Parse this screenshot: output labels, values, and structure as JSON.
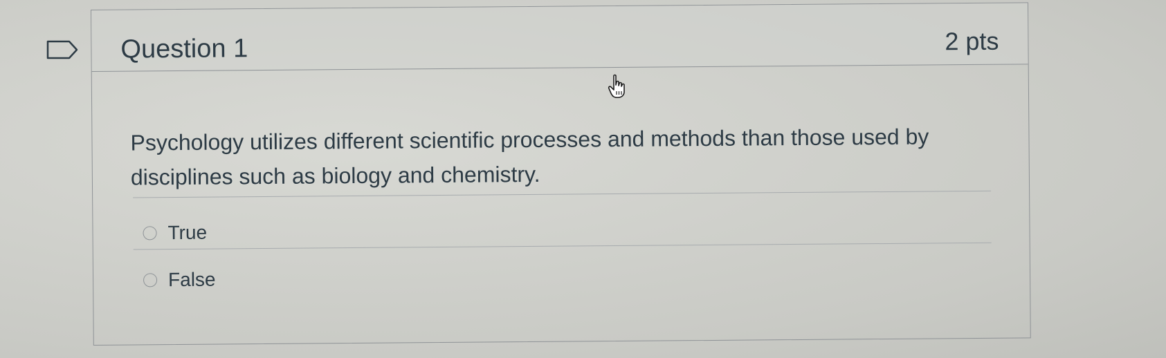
{
  "question": {
    "title": "Question 1",
    "points": "2 pts",
    "text": "Psychology utilizes different scientific processes and methods than those used by disciplines such as biology and chemistry.",
    "answers": [
      {
        "label": "True",
        "selected": false
      },
      {
        "label": "False",
        "selected": false
      }
    ]
  },
  "icons": {
    "bookmark": "bookmark-flag-icon",
    "cursor": "hand-pointer-icon"
  },
  "colors": {
    "text": "#2d3b45",
    "border": "#8e9296",
    "background": "#cfd0cb"
  }
}
